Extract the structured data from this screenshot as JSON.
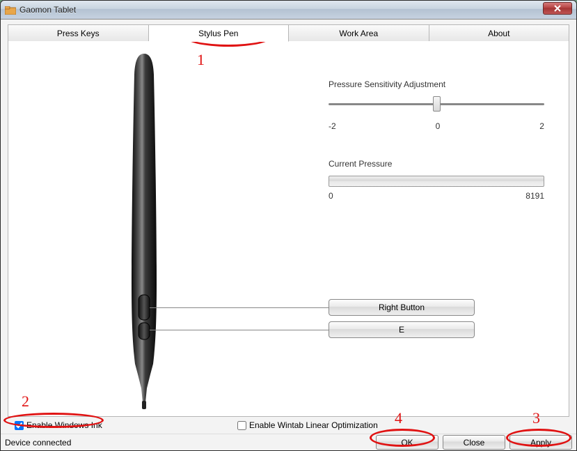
{
  "window": {
    "title": "Gaomon Tablet"
  },
  "tabs": {
    "press_keys": "Press Keys",
    "stylus_pen": "Stylus Pen",
    "work_area": "Work Area",
    "about": "About"
  },
  "pressure_section": {
    "label": "Pressure Sensitivity Adjustment",
    "min": "-2",
    "mid": "0",
    "max": "2"
  },
  "current_pressure": {
    "label": "Current Pressure",
    "min": "0",
    "max": "8191"
  },
  "pen_buttons": {
    "upper": "Right Button",
    "lower": "E"
  },
  "checkboxes": {
    "windows_ink": "Enable  Windows Ink",
    "wintab": "Enable Wintab Linear Optimization"
  },
  "status": {
    "text": "Device connected"
  },
  "dialog_buttons": {
    "ok": "OK",
    "close": "Close",
    "apply": "Apply"
  },
  "annotations": {
    "n1": "1",
    "n2": "2",
    "n3": "3",
    "n4": "4"
  }
}
